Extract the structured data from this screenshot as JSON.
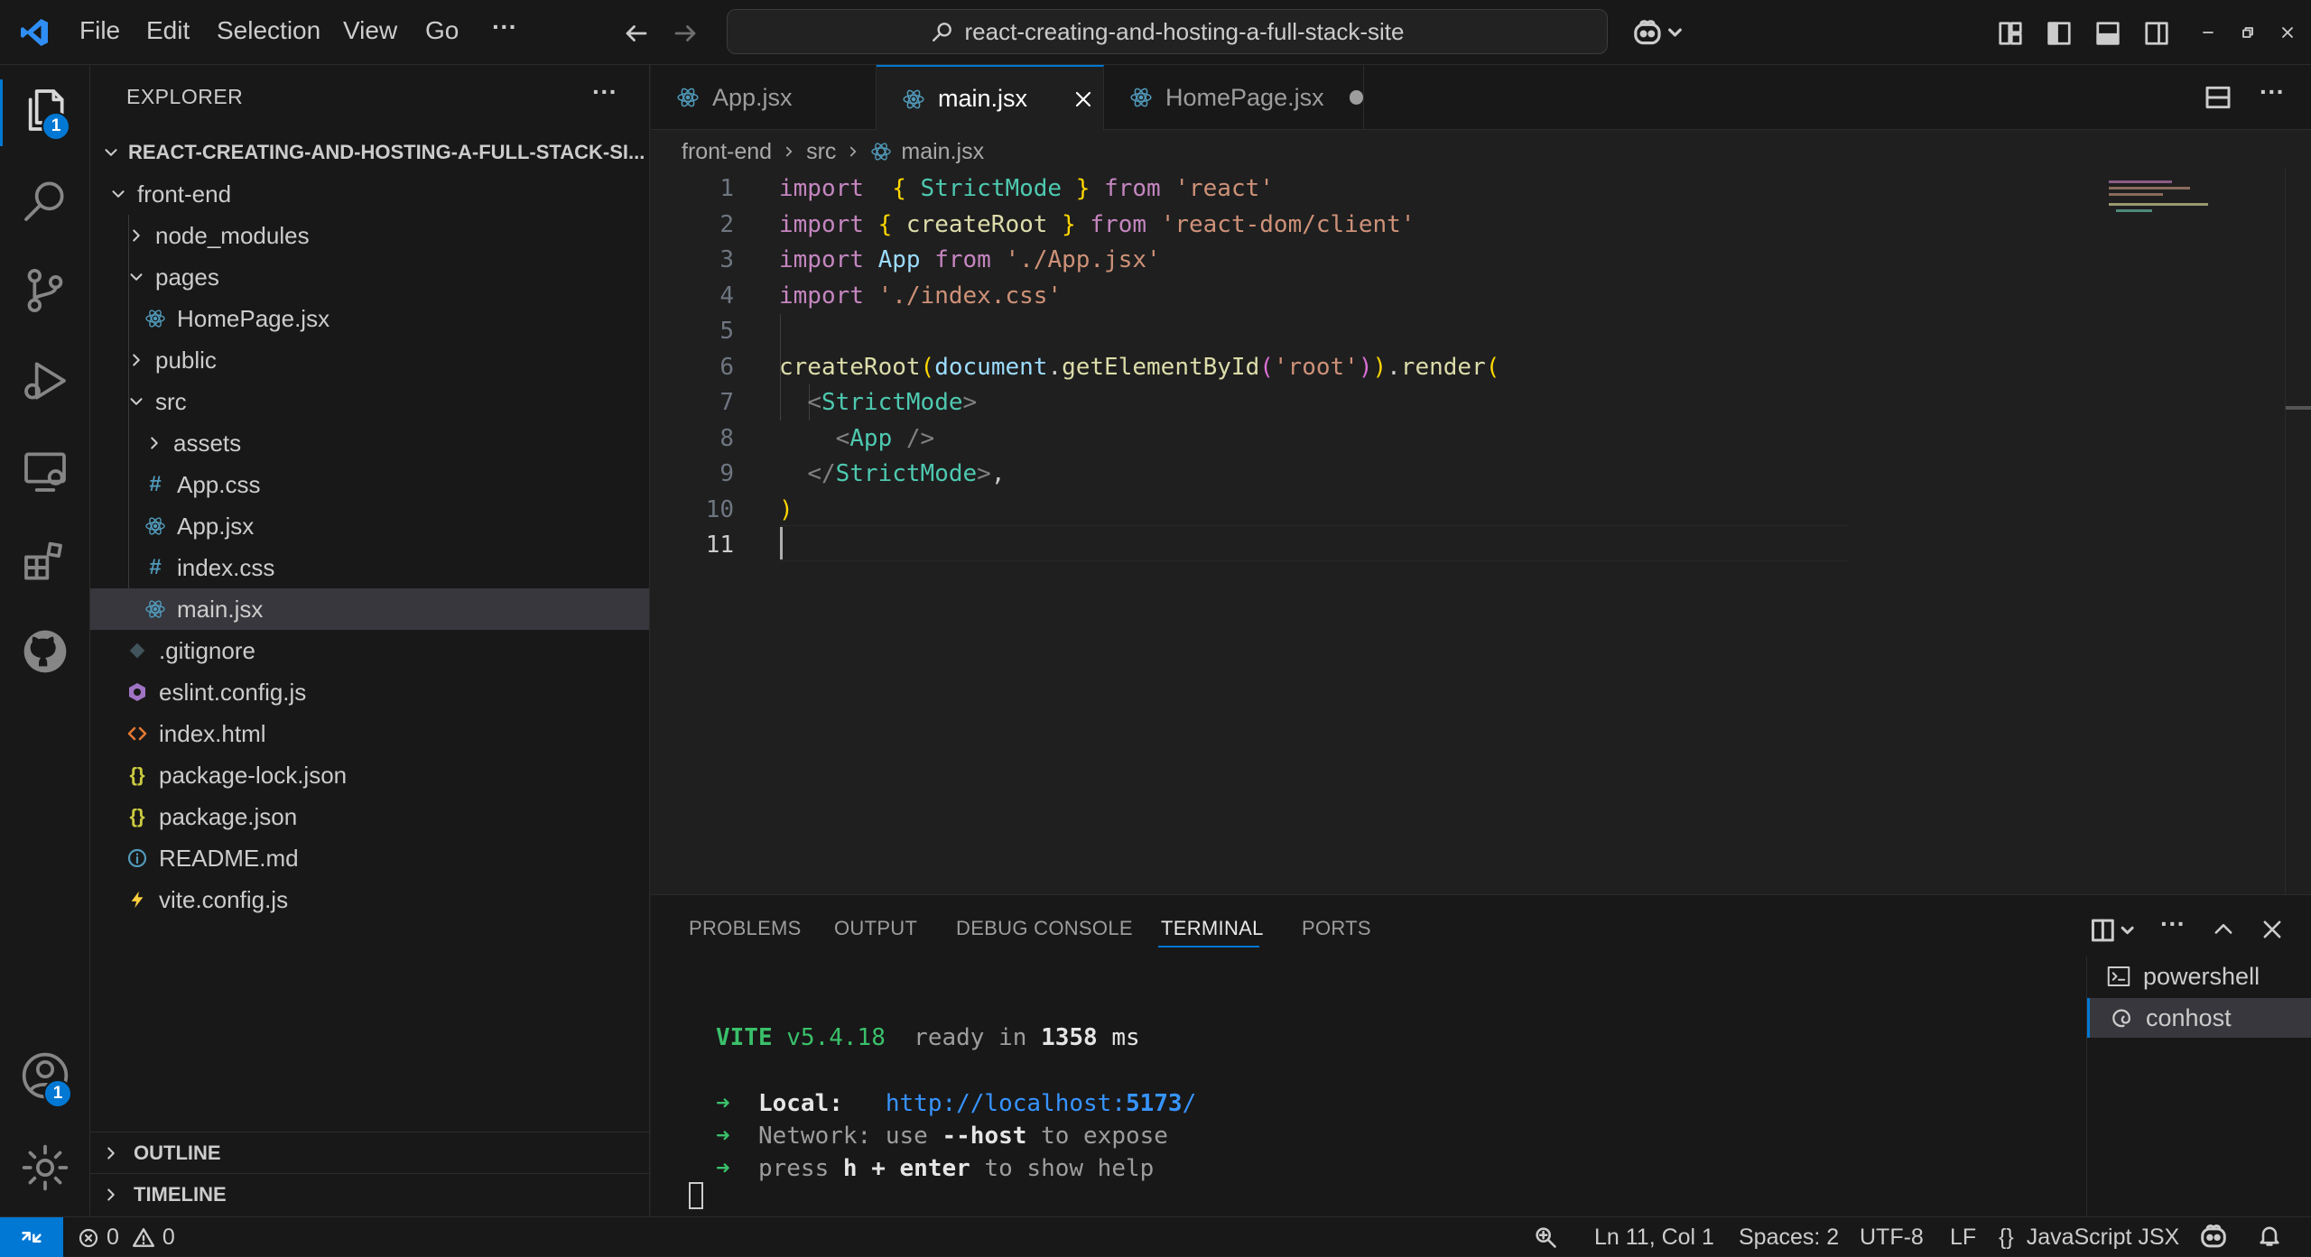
{
  "titlebar": {
    "menus": [
      "File",
      "Edit",
      "Selection",
      "View",
      "Go"
    ],
    "more": "···",
    "search_text": "react-creating-and-hosting-a-full-stack-site",
    "icon_names": [
      "vscode-logo-icon",
      "back-arrow-icon",
      "forward-arrow-icon",
      "search-icon",
      "copilot-icon",
      "customize-layout-icon",
      "toggle-sidebar-icon",
      "toggle-panel-icon",
      "toggle-secondary-sidebar-icon",
      "minimize-icon",
      "restore-icon",
      "close-window-icon"
    ]
  },
  "activity_bar": {
    "explorer_badge": "1",
    "accounts_badge": "1"
  },
  "sidebar": {
    "title": "EXPLORER",
    "more": "···",
    "root": "REACT-CREATING-AND-HOSTING-A-FULL-STACK-SI...",
    "tree": [
      {
        "label": "front-end",
        "type": "folder-open",
        "depth": 1
      },
      {
        "label": "node_modules",
        "type": "folder",
        "depth": 2
      },
      {
        "label": "pages",
        "type": "folder-open",
        "depth": 2
      },
      {
        "label": "HomePage.jsx",
        "type": "react",
        "depth": 3
      },
      {
        "label": "public",
        "type": "folder",
        "depth": 2
      },
      {
        "label": "src",
        "type": "folder-open",
        "depth": 2
      },
      {
        "label": "assets",
        "type": "folder",
        "depth": 3
      },
      {
        "label": "App.css",
        "type": "css",
        "depth": 3
      },
      {
        "label": "App.jsx",
        "type": "react",
        "depth": 3
      },
      {
        "label": "index.css",
        "type": "css",
        "depth": 3
      },
      {
        "label": "main.jsx",
        "type": "react",
        "depth": 3,
        "selected": true
      },
      {
        "label": ".gitignore",
        "type": "git",
        "depth": 2
      },
      {
        "label": "eslint.config.js",
        "type": "eslint",
        "depth": 2
      },
      {
        "label": "index.html",
        "type": "html",
        "depth": 2
      },
      {
        "label": "package-lock.json",
        "type": "json",
        "depth": 2
      },
      {
        "label": "package.json",
        "type": "json",
        "depth": 2
      },
      {
        "label": "README.md",
        "type": "info",
        "depth": 2
      },
      {
        "label": "vite.config.js",
        "type": "vite",
        "depth": 2
      }
    ],
    "outline": "OUTLINE",
    "timeline": "TIMELINE"
  },
  "tabs": [
    {
      "label": "App.jsx",
      "active": false
    },
    {
      "label": "main.jsx",
      "active": true
    },
    {
      "label": "HomePage.jsx",
      "active": false,
      "dirty": true
    }
  ],
  "breadcrumb": [
    "front-end",
    "src",
    "main.jsx"
  ],
  "editor": {
    "current_line": 11,
    "lines": [
      [
        [
          "kw",
          "import"
        ],
        [
          "",
          "  "
        ],
        [
          "br1",
          "{"
        ],
        [
          "",
          " "
        ],
        [
          "cls",
          "StrictMode"
        ],
        [
          "",
          " "
        ],
        [
          "br1",
          "}"
        ],
        [
          "",
          " "
        ],
        [
          "kw",
          "from"
        ],
        [
          "",
          " "
        ],
        [
          "str",
          "'react'"
        ]
      ],
      [
        [
          "kw",
          "import"
        ],
        [
          "",
          " "
        ],
        [
          "br1",
          "{"
        ],
        [
          "",
          " "
        ],
        [
          "fn",
          "createRoot"
        ],
        [
          "",
          " "
        ],
        [
          "br1",
          "}"
        ],
        [
          "",
          " "
        ],
        [
          "kw",
          "from"
        ],
        [
          "",
          " "
        ],
        [
          "str",
          "'react-dom/client'"
        ]
      ],
      [
        [
          "kw",
          "import"
        ],
        [
          "",
          " "
        ],
        [
          "var",
          "App"
        ],
        [
          "",
          " "
        ],
        [
          "kw",
          "from"
        ],
        [
          "",
          " "
        ],
        [
          "str",
          "'./App.jsx'"
        ]
      ],
      [
        [
          "kw",
          "import"
        ],
        [
          "",
          " "
        ],
        [
          "str",
          "'./index.css'"
        ]
      ],
      [],
      [
        [
          "fn",
          "createRoot"
        ],
        [
          "br1",
          "("
        ],
        [
          "var",
          "document"
        ],
        [
          "",
          "."
        ],
        [
          "fn",
          "getElementById"
        ],
        [
          "br2",
          "("
        ],
        [
          "str",
          "'root'"
        ],
        [
          "br2",
          ")"
        ],
        [
          "br1",
          ")"
        ],
        [
          "",
          "."
        ],
        [
          "fn",
          "render"
        ],
        [
          "br1",
          "("
        ]
      ],
      [
        [
          "",
          "  "
        ],
        [
          "tag",
          "<"
        ],
        [
          "cls",
          "StrictMode"
        ],
        [
          "tag",
          ">"
        ]
      ],
      [
        [
          "",
          "    "
        ],
        [
          "tag",
          "<"
        ],
        [
          "cls",
          "App"
        ],
        [
          "",
          " "
        ],
        [
          "tag",
          "/>"
        ]
      ],
      [
        [
          "",
          "  "
        ],
        [
          "tag",
          "</"
        ],
        [
          "cls",
          "StrictMode"
        ],
        [
          "tag",
          ">"
        ],
        [
          "",
          ","
        ]
      ],
      [
        [
          "br1",
          ")"
        ]
      ],
      []
    ]
  },
  "panel": {
    "tabs": [
      "PROBLEMS",
      "OUTPUT",
      "DEBUG CONSOLE",
      "TERMINAL",
      "PORTS"
    ],
    "active_tab": "TERMINAL",
    "terminal": {
      "vite_name": "VITE",
      "vite_version": "v5.4.18",
      "ready": "ready in",
      "ready_ms": "1358",
      "ms": "ms",
      "arrow": "➜",
      "local_label": "Local:",
      "local_url_prefix": "http://localhost:",
      "local_port": "5173",
      "local_url_suffix": "/",
      "network_label": "Network:",
      "network_use": "use",
      "network_flag": "--host",
      "network_expose": "to expose",
      "press": "press",
      "h_key": "h + enter",
      "help": "to show help"
    },
    "terminals": [
      {
        "label": "powershell",
        "selected": false
      },
      {
        "label": "conhost",
        "selected": true
      }
    ]
  },
  "statusbar": {
    "errors": "0",
    "warnings": "0",
    "position": "Ln 11, Col 1",
    "spaces": "Spaces: 2",
    "encoding": "UTF-8",
    "eol": "LF",
    "language_braces": "{}",
    "language": "JavaScript JSX"
  },
  "colors": {
    "accent": "#0078d4",
    "keyword": "#c586c0",
    "string": "#ce9178",
    "function": "#dcdcaa",
    "type": "#4ec9b0",
    "variable": "#9cdcfe",
    "vite_green": "#3ac06a",
    "url_blue": "#3794ff"
  }
}
